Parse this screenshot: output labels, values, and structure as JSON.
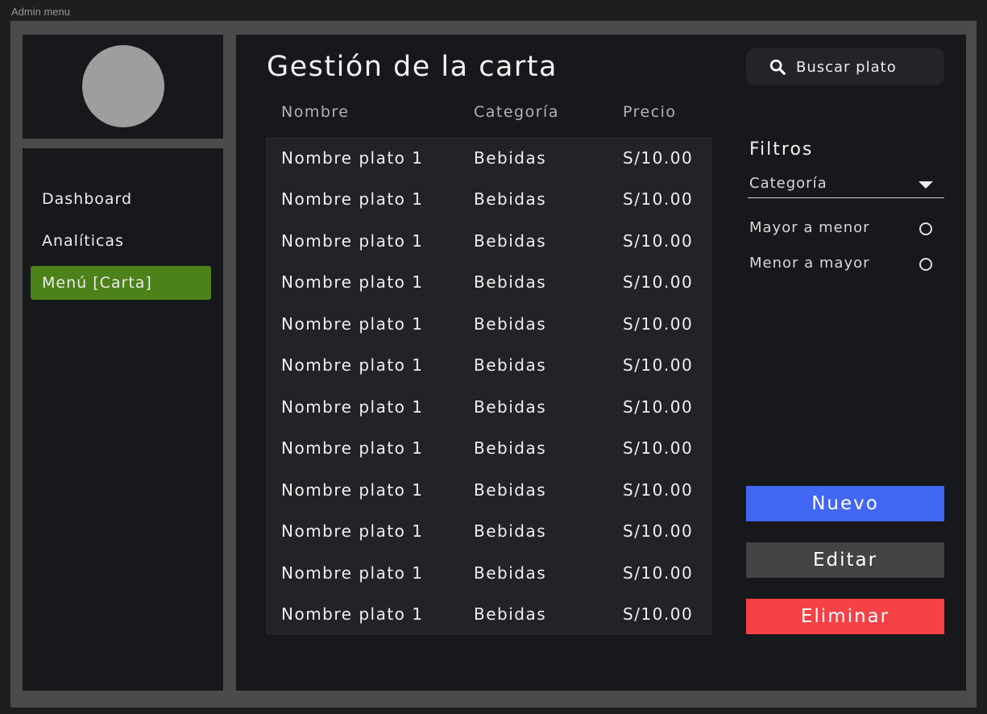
{
  "window": {
    "frame_label": "Admin menu"
  },
  "sidebar": {
    "items": [
      {
        "label": "Dashboard",
        "active": false
      },
      {
        "label": "Analíticas",
        "active": false
      },
      {
        "label": "Menú [Carta]",
        "active": true
      }
    ]
  },
  "main": {
    "title": "Gestión de la carta",
    "search": {
      "icon": "search-icon",
      "label": "Buscar plato"
    },
    "table": {
      "columns": [
        "Nombre",
        "Categoría",
        "Precio"
      ],
      "rows": [
        [
          "Nombre plato 1",
          "Bebidas",
          "S/10.00"
        ],
        [
          "Nombre plato 1",
          "Bebidas",
          "S/10.00"
        ],
        [
          "Nombre plato 1",
          "Bebidas",
          "S/10.00"
        ],
        [
          "Nombre plato 1",
          "Bebidas",
          "S/10.00"
        ],
        [
          "Nombre plato 1",
          "Bebidas",
          "S/10.00"
        ],
        [
          "Nombre plato 1",
          "Bebidas",
          "S/10.00"
        ],
        [
          "Nombre plato 1",
          "Bebidas",
          "S/10.00"
        ],
        [
          "Nombre plato 1",
          "Bebidas",
          "S/10.00"
        ],
        [
          "Nombre plato 1",
          "Bebidas",
          "S/10.00"
        ],
        [
          "Nombre plato 1",
          "Bebidas",
          "S/10.00"
        ],
        [
          "Nombre plato 1",
          "Bebidas",
          "S/10.00"
        ],
        [
          "Nombre plato 1",
          "Bebidas",
          "S/10.00"
        ]
      ]
    }
  },
  "filters": {
    "title": "Filtros",
    "category_select": {
      "value": "Categoría",
      "icon": "caret-down-icon"
    },
    "sort_options": [
      {
        "label": "Mayor a menor",
        "selected": false
      },
      {
        "label": "Menor a mayor",
        "selected": false
      }
    ]
  },
  "actions": {
    "new": {
      "label": "Nuevo",
      "color": "#4267f5"
    },
    "edit": {
      "label": "Editar",
      "color": "#444444"
    },
    "delete": {
      "label": "Eliminar",
      "color": "#f64147"
    }
  },
  "colors": {
    "background": "#1e1e1e",
    "frame": "#4b4b4b",
    "panel": "#17181b",
    "table": "#222327",
    "active_nav": "#4d8119",
    "avatar": "#9e9e9e"
  }
}
